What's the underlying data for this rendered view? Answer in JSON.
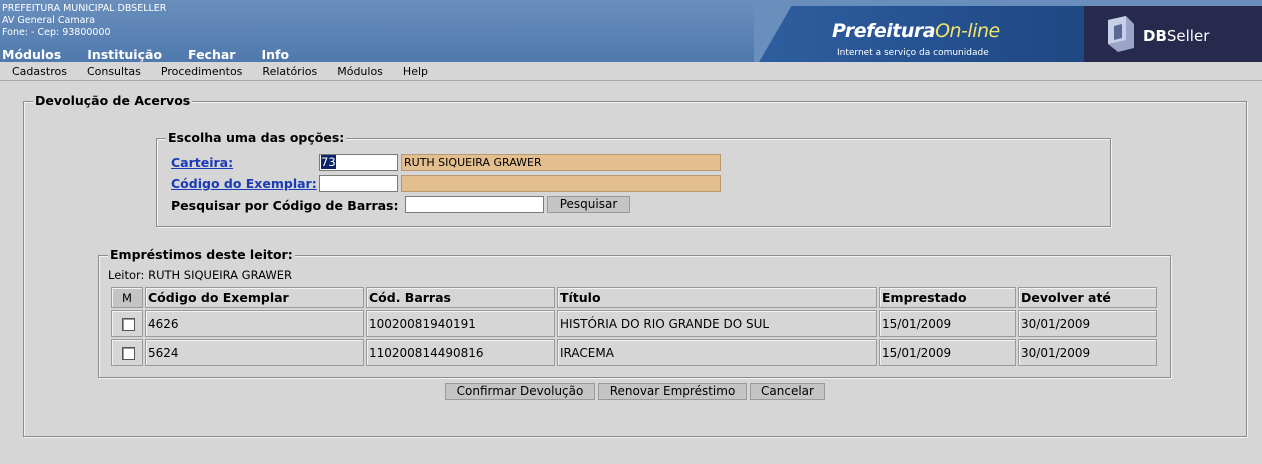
{
  "header": {
    "org_lines": [
      "PREFEITURA MUNICIPAL DBSELLER",
      "AV General Camara",
      "Fone:   -  Cep: 93800000"
    ],
    "top_menu": [
      "Módulos",
      "Instituição",
      "Fechar",
      "Info"
    ],
    "banner_logo_main": "Prefeitura",
    "banner_logo_accent": "On-line",
    "banner_tagline": "Internet a serviço da comunidade",
    "dbseller_logo_bold": "DB",
    "dbseller_logo_rest": "Seller"
  },
  "menubar": [
    "Cadastros",
    "Consultas",
    "Procedimentos",
    "Relatórios",
    "Módulos",
    "Help"
  ],
  "main": {
    "legend": "Devolução de Acervos",
    "options": {
      "legend": "Escolha uma das opções:",
      "carteira_label": "Carteira:",
      "carteira_value": "73",
      "carteira_name": "RUTH SIQUEIRA GRAWER",
      "exemplar_label": "Código do Exemplar:",
      "exemplar_value": "",
      "exemplar_desc": "",
      "barcode_label": "Pesquisar por Código de Barras:",
      "barcode_value": "",
      "search_button": "Pesquisar"
    },
    "loans": {
      "legend": "Empréstimos deste leitor:",
      "reader_line": "Leitor: RUTH SIQUEIRA GRAWER",
      "columns": [
        "M",
        "Código do Exemplar",
        "Cód. Barras",
        "Título",
        "Emprestado",
        "Devolver até"
      ],
      "rows": [
        {
          "checked": false,
          "codigo": "4626",
          "barras": "10020081940191",
          "titulo": "HISTÓRIA DO RIO GRANDE DO SUL",
          "emprestado": "15/01/2009",
          "devolver": "30/01/2009"
        },
        {
          "checked": false,
          "codigo": "5624",
          "barras": "110200814490816",
          "titulo": "IRACEMA",
          "emprestado": "15/01/2009",
          "devolver": "30/01/2009"
        }
      ]
    },
    "actions": {
      "confirm": "Confirmar Devolução",
      "renew": "Renovar Empréstimo",
      "cancel": "Cancelar"
    }
  },
  "colors": {
    "header_blue": "#4f79ad",
    "readonly_fill": "#e3be8f",
    "link_blue": "#1a3ab8",
    "selection": "#0a246a"
  }
}
